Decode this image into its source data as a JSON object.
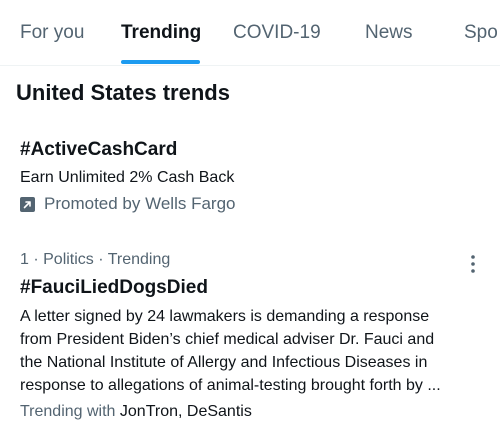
{
  "tabs": [
    {
      "label": "For you",
      "active": false
    },
    {
      "label": "Trending",
      "active": true
    },
    {
      "label": "COVID-19",
      "active": false
    },
    {
      "label": "News",
      "active": false
    },
    {
      "label": "Spo",
      "active": false
    }
  ],
  "section": {
    "title": "United States trends"
  },
  "promoted": {
    "hashtag": "#ActiveCashCard",
    "description": "Earn Unlimited 2% Cash Back",
    "promoted_by": "Promoted by Wells Fargo",
    "icon": "promoted-arrow-icon"
  },
  "trend": {
    "meta": "1 · Politics · Trending",
    "hashtag": "#FauciLiedDogsDied",
    "description_lines": [
      "A letter signed by 24 lawmakers is demanding a response",
      "from President Biden’s chief medical adviser Dr. Fauci and",
      "the National Institute of Allergy and Infectious Diseases in",
      "response to allegations of animal-testing brought forth by ..."
    ],
    "trending_with_label": "Trending with",
    "trending_with_names": "JonTron, DeSantis",
    "more_icon": "more-vertical-icon"
  },
  "colors": {
    "accent": "#1d9bf0",
    "text": "#0f1419",
    "muted": "#536471",
    "divider": "#eff3f4"
  }
}
